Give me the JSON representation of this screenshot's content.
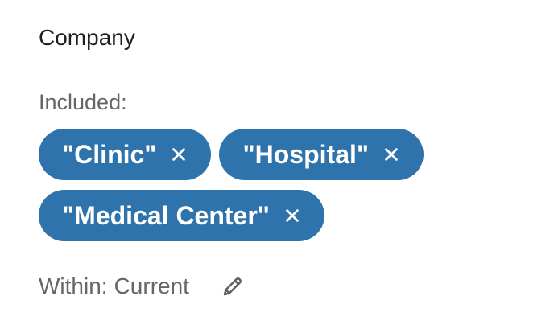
{
  "section": {
    "title": "Company"
  },
  "filter": {
    "included_label": "Included:",
    "chips": [
      {
        "label": "\"Clinic\"",
        "remove_icon": "close-icon"
      },
      {
        "label": "\"Hospital\"",
        "remove_icon": "close-icon"
      },
      {
        "label": "\"Medical Center\"",
        "remove_icon": "close-icon"
      }
    ],
    "within_label": "Within:",
    "within_value": "Current",
    "edit_icon": "pencil-icon"
  },
  "colors": {
    "chip_background": "#2f73ad",
    "chip_text": "#ffffff",
    "muted_text": "#666666",
    "title_text": "#1f1f1f"
  }
}
